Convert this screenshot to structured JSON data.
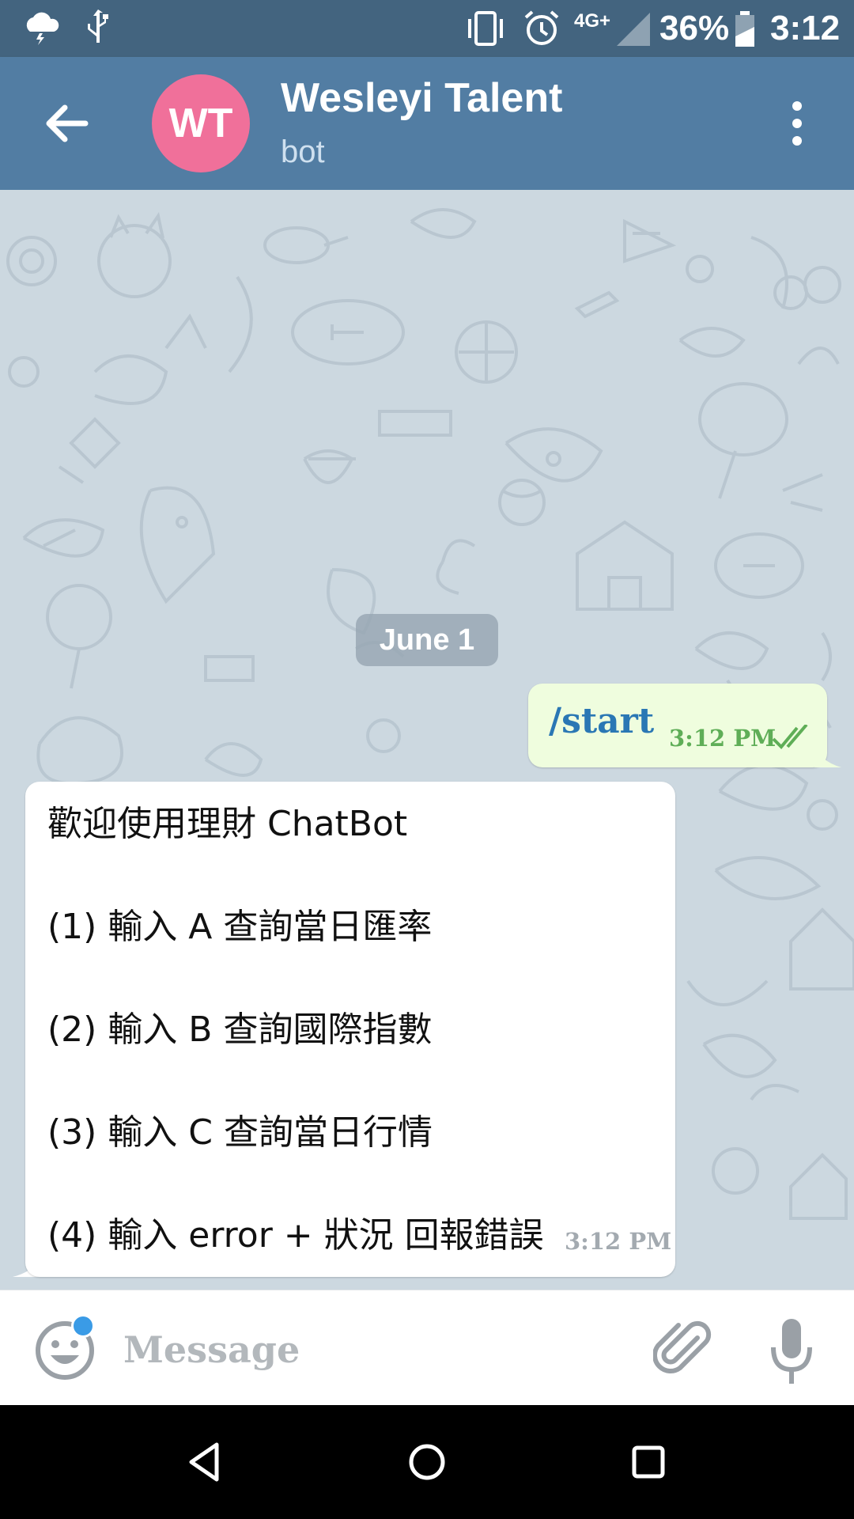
{
  "status_bar": {
    "battery_percent": "36%",
    "time": "3:12",
    "network": "4G+",
    "icons": [
      "weather-storm-icon",
      "usb-icon",
      "vibrate-icon",
      "alarm-icon",
      "signal-icon",
      "battery-icon"
    ]
  },
  "header": {
    "avatar_initials": "WT",
    "avatar_color": "#f0709a",
    "title": "Wesleyi Talent",
    "subtitle": "bot"
  },
  "chat": {
    "date_label": "June 1",
    "outgoing": {
      "text": "/start",
      "time": "3:12 PM"
    },
    "incoming": {
      "lines": [
        "歡迎使用理財 ChatBot",
        "(1) 輸入 A 查詢當日匯率",
        "(2) 輸入 B 查詢國際指數",
        "(3) 輸入 C 查詢當日行情",
        "(4) 輸入 error + 狀況 回報錯誤"
      ],
      "time": "3:12 PM"
    }
  },
  "input_bar": {
    "placeholder": "Message",
    "value": ""
  },
  "colors": {
    "status_bar": "#43647f",
    "app_bar": "#527da3",
    "outgoing_bubble": "#effdde",
    "outgoing_text": "#2a77b4",
    "accent_dot": "#3a9be6"
  }
}
